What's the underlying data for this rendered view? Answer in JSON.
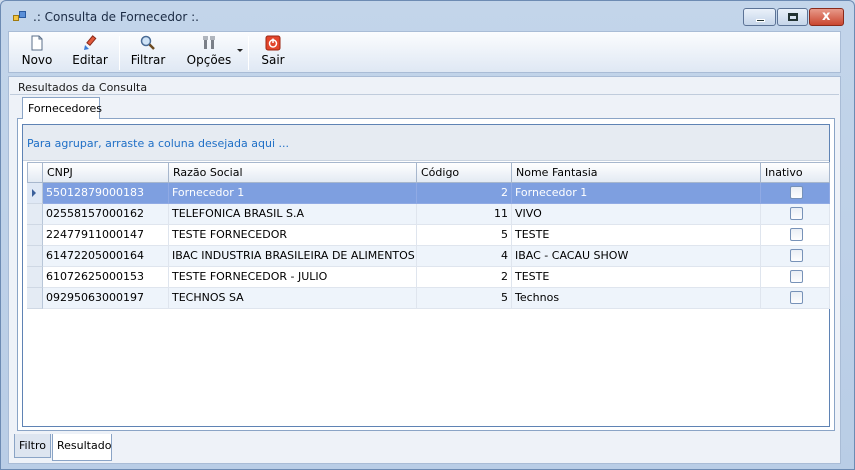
{
  "window": {
    "title": ".: Consulta de Fornecedor :.",
    "controls": {
      "minimize": "",
      "maximize": "",
      "close": "x"
    }
  },
  "toolbar": {
    "items": [
      {
        "label": "Novo",
        "icon": "new-document-icon"
      },
      {
        "label": "Editar",
        "icon": "edit-brush-icon"
      },
      {
        "label": "Filtrar",
        "icon": "magnifier-icon"
      },
      {
        "label": "Opções",
        "icon": "tools-icon",
        "has_dropdown": true
      },
      {
        "label": "Sair",
        "icon": "power-icon"
      }
    ]
  },
  "group": {
    "title": "Resultados da Consulta"
  },
  "tabs": {
    "top": "Fornecedores",
    "bottom": [
      "Filtro",
      "Resultado"
    ],
    "active_bottom": "Resultado"
  },
  "grid": {
    "group_hint": "Para agrupar, arraste a coluna desejada aqui ...",
    "columns": [
      "CNPJ",
      "Razão Social",
      "Código",
      "Nome Fantasia",
      "Inativo"
    ],
    "rows": [
      {
        "cnpj": "55012879000183",
        "razao": "Fornecedor 1",
        "codigo": "2",
        "fantasia": "Fornecedor 1",
        "inativo": false,
        "selected": true
      },
      {
        "cnpj": "02558157000162",
        "razao": "TELEFONICA BRASIL S.A",
        "codigo": "11",
        "fantasia": "VIVO",
        "inativo": false
      },
      {
        "cnpj": "22477911000147",
        "razao": "TESTE FORNECEDOR",
        "codigo": "5",
        "fantasia": "TESTE",
        "inativo": false
      },
      {
        "cnpj": "61472205000164",
        "razao": "IBAC INDUSTRIA BRASILEIRA DE ALIMENTOS E...",
        "codigo": "4",
        "fantasia": "IBAC - CACAU SHOW",
        "inativo": false
      },
      {
        "cnpj": "61072625000153",
        "razao": "TESTE FORNECEDOR - JULIO",
        "codigo": "2",
        "fantasia": "TESTE",
        "inativo": false
      },
      {
        "cnpj": "09295063000197",
        "razao": "TECHNOS SA",
        "codigo": "5",
        "fantasia": "Technos",
        "inativo": false
      }
    ]
  },
  "colors": {
    "selection": "#7e9fe0",
    "hint": "#1f6fc6",
    "title_bg": "#c3d5ea"
  }
}
